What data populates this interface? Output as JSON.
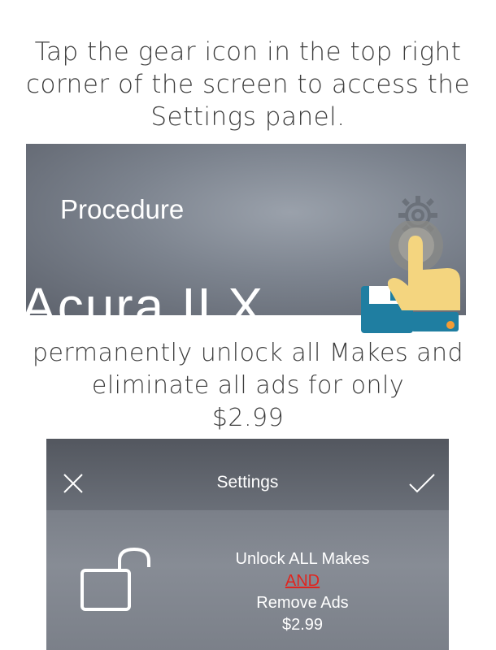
{
  "caption_top": {
    "line1": "Tap the gear icon in the top right",
    "line2": "corner of the screen to access the",
    "line3": "Settings panel."
  },
  "screenshot1": {
    "label": "Procedure",
    "title": "Acura ILX",
    "icons": [
      "gear-icon",
      "hand-pointer-icon",
      "floppy-disk-icon"
    ]
  },
  "caption_mid": {
    "line1": "permanently unlock all Makes and",
    "line2": "eliminate all ads for only",
    "line3": "$2.99"
  },
  "screenshot2": {
    "header_title": "Settings",
    "unlock_line1": "Unlock ALL Makes",
    "unlock_and": "AND",
    "unlock_line3": "Remove Ads",
    "price": "$2.99",
    "icons": [
      "close-icon",
      "checkmark-icon",
      "unlock-icon"
    ],
    "accent_red": "#e0251f"
  }
}
